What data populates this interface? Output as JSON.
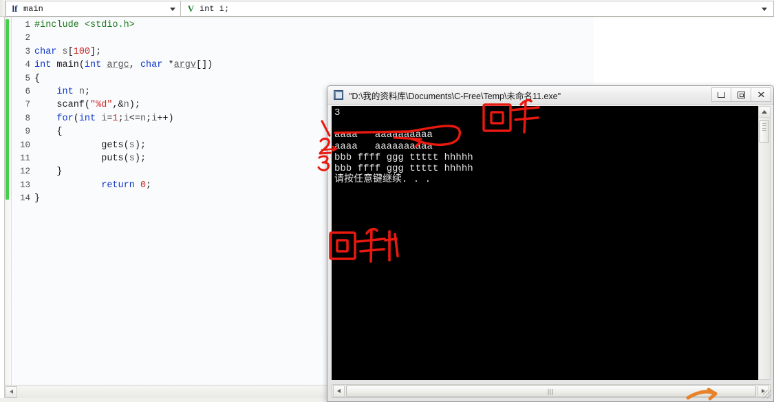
{
  "ide": {
    "function_combo": {
      "icon": "function-icon",
      "icon_glyph": "lf",
      "value": "main"
    },
    "variable_combo": {
      "icon": "variable-icon",
      "icon_glyph": "V",
      "value": "int i;"
    },
    "dropdown_icon": "chevron-down-icon",
    "code": {
      "language": "c",
      "lines": [
        {
          "no": "1",
          "tokens": [
            {
              "t": "pre",
              "v": "#include <stdio.h>"
            }
          ]
        },
        {
          "no": "2",
          "tokens": []
        },
        {
          "no": "3",
          "tokens": [
            {
              "t": "kw",
              "v": "char"
            },
            {
              "t": "plain",
              "v": " "
            },
            {
              "t": "var",
              "v": "s"
            },
            {
              "t": "plain",
              "v": "["
            },
            {
              "t": "num",
              "v": "100"
            },
            {
              "t": "plain",
              "v": "];"
            }
          ]
        },
        {
          "no": "4",
          "tokens": [
            {
              "t": "kw",
              "v": "int"
            },
            {
              "t": "plain",
              "v": " main("
            },
            {
              "t": "kw",
              "v": "int"
            },
            {
              "t": "plain",
              "v": " "
            },
            {
              "t": "id",
              "v": "argc"
            },
            {
              "t": "plain",
              "v": ", "
            },
            {
              "t": "kw",
              "v": "char"
            },
            {
              "t": "plain",
              "v": " *"
            },
            {
              "t": "id",
              "v": "argv"
            },
            {
              "t": "plain",
              "v": "[])"
            }
          ]
        },
        {
          "no": "5",
          "tokens": [
            {
              "t": "plain",
              "v": "{"
            }
          ]
        },
        {
          "no": "6",
          "tokens": [
            {
              "t": "plain",
              "v": "    "
            },
            {
              "t": "kw",
              "v": "int"
            },
            {
              "t": "plain",
              "v": " "
            },
            {
              "t": "var",
              "v": "n"
            },
            {
              "t": "plain",
              "v": ";"
            }
          ]
        },
        {
          "no": "7",
          "tokens": [
            {
              "t": "plain",
              "v": "    scanf("
            },
            {
              "t": "str",
              "v": "\"%d\""
            },
            {
              "t": "plain",
              "v": ",&"
            },
            {
              "t": "var",
              "v": "n"
            },
            {
              "t": "plain",
              "v": ");"
            }
          ]
        },
        {
          "no": "8",
          "tokens": [
            {
              "t": "plain",
              "v": "    "
            },
            {
              "t": "kw",
              "v": "for"
            },
            {
              "t": "plain",
              "v": "("
            },
            {
              "t": "kw",
              "v": "int"
            },
            {
              "t": "plain",
              "v": " "
            },
            {
              "t": "var",
              "v": "i"
            },
            {
              "t": "plain",
              "v": "="
            },
            {
              "t": "num",
              "v": "1"
            },
            {
              "t": "plain",
              "v": ";"
            },
            {
              "t": "var",
              "v": "i"
            },
            {
              "t": "plain",
              "v": "<="
            },
            {
              "t": "var",
              "v": "n"
            },
            {
              "t": "plain",
              "v": ";"
            },
            {
              "t": "var",
              "v": "i"
            },
            {
              "t": "plain",
              "v": "++)"
            }
          ]
        },
        {
          "no": "9",
          "tokens": [
            {
              "t": "plain",
              "v": "    {"
            }
          ]
        },
        {
          "no": "10",
          "tokens": [
            {
              "t": "plain",
              "v": "            gets("
            },
            {
              "t": "var",
              "v": "s"
            },
            {
              "t": "plain",
              "v": ");"
            }
          ]
        },
        {
          "no": "11",
          "tokens": [
            {
              "t": "plain",
              "v": "            puts("
            },
            {
              "t": "var",
              "v": "s"
            },
            {
              "t": "plain",
              "v": ");"
            }
          ]
        },
        {
          "no": "12",
          "tokens": [
            {
              "t": "plain",
              "v": "    }"
            }
          ]
        },
        {
          "no": "13",
          "tokens": [
            {
              "t": "plain",
              "v": "            "
            },
            {
              "t": "kw",
              "v": "return"
            },
            {
              "t": "plain",
              "v": " "
            },
            {
              "t": "num",
              "v": "0"
            },
            {
              "t": "plain",
              "v": ";"
            }
          ]
        },
        {
          "no": "14",
          "tokens": [
            {
              "t": "plain",
              "v": "}"
            }
          ]
        }
      ]
    },
    "hscroll": {
      "left_arrow_icon": "arrow-left-icon"
    },
    "change_bar_color": "#44d14a"
  },
  "console_window": {
    "title": "\"D:\\我的资料库\\Documents\\C-Free\\Temp\\未命名11.exe\"",
    "app_icon": "console-app-icon",
    "buttons": {
      "minimize": {
        "icon": "minimize-icon",
        "label": "—"
      },
      "maximize": {
        "icon": "restore-icon",
        "label": "❐"
      },
      "close": {
        "icon": "close-icon",
        "label": "✕"
      }
    },
    "output_lines": [
      "3",
      "",
      "aaaa   aaaaaaaaaa",
      "aaaa   aaaaaaaaaa",
      "bbb ffff ggg ttttt hhhhh",
      "bbb ffff ggg ttttt hhhhh",
      "请按任意键继续. . ."
    ],
    "text_color": "#e6e6e6",
    "background_color": "#000000",
    "vscrollbar": {
      "up_arrow_icon": "arrow-up-icon",
      "thumb": "scroll-thumb"
    },
    "hscrollbar": {
      "left_arrow_icon": "arrow-left-icon",
      "right_arrow_icon": "arrow-right-icon",
      "thumb": "scroll-thumb"
    },
    "resize_grip_icon": "resize-grip-icon"
  },
  "annotations": {
    "ink_color": "#e8190f",
    "marks": [
      {
        "name": "callout-number-1",
        "text": "1"
      },
      {
        "name": "callout-number-2",
        "text": "2"
      },
      {
        "name": "callout-number-3",
        "text": "3"
      },
      {
        "name": "handwriting-enter-top",
        "text": "回车"
      },
      {
        "name": "handwriting-enter-bottom",
        "text": "回车"
      }
    ],
    "orange_mark_color": "#e8822a"
  }
}
